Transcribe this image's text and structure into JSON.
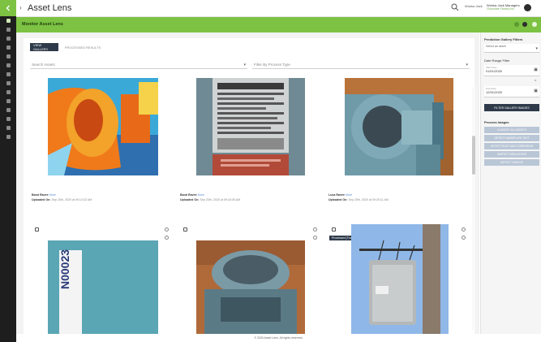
{
  "app": {
    "title": "Asset Lens"
  },
  "header": {
    "user_short": "Wonka Jack",
    "user_name": "Wonka Jack Managers",
    "user_org": "Chocolate Factory Inc",
    "help_glyph": "?"
  },
  "page": {
    "title": "Monitor Asset Lens"
  },
  "tabs": [
    {
      "label": "VIEW GALLERY"
    },
    {
      "label": "PROCESSED RESULTS"
    }
  ],
  "filters": {
    "search": {
      "placeholder": "Search Assets"
    },
    "process_type": {
      "placeholder": "Filter By Process Type"
    }
  },
  "photos": [
    {
      "name": "Band Ravee",
      "link": "More",
      "uploaded_label": "Uploaded On:",
      "uploaded": "Sep 20th, 2020 at 09:14:32 AM"
    },
    {
      "name": "Band Ravee",
      "link": "More",
      "uploaded_label": "Uploaded On:",
      "uploaded": "Sep 20th, 2020 at 09:18:05 AM"
    },
    {
      "name": "Luca Ravee",
      "link": "More",
      "uploaded_label": "Uploaded On:",
      "uploaded": "Sep 20th, 2020 at 09:20:11 AM"
    },
    {
      "tag": ""
    },
    {
      "tag": ""
    },
    {
      "tag": "Processed (Transformer identified)"
    }
  ],
  "sticker_text": "N00023",
  "right_panel": {
    "section1": "Prediction Gallery Filters",
    "select_placeholder": "Select an asset",
    "date_heading": "Date Range Filter",
    "from_label": "Start Date",
    "from_value": "01/01/2020",
    "to_label": "End Date",
    "to_value": "12/31/2020",
    "apply_label": "FILTER GALLERY IMAGES",
    "section2": "Process Images",
    "buttons": [
      "CLASSIFY ALL ASSETS",
      "DETECT NAMEPLATE TEXT",
      "DETECT RUST AND CORROSION",
      "INSPECT INSULATORS",
      "DETECT CRACKS"
    ]
  },
  "footer": {
    "text": "© 2020 Asset Lens. All rights reserved."
  },
  "colors": {
    "accent": "#7dc243",
    "navy": "#2e3a4a",
    "rail": "#1e1e1e"
  }
}
